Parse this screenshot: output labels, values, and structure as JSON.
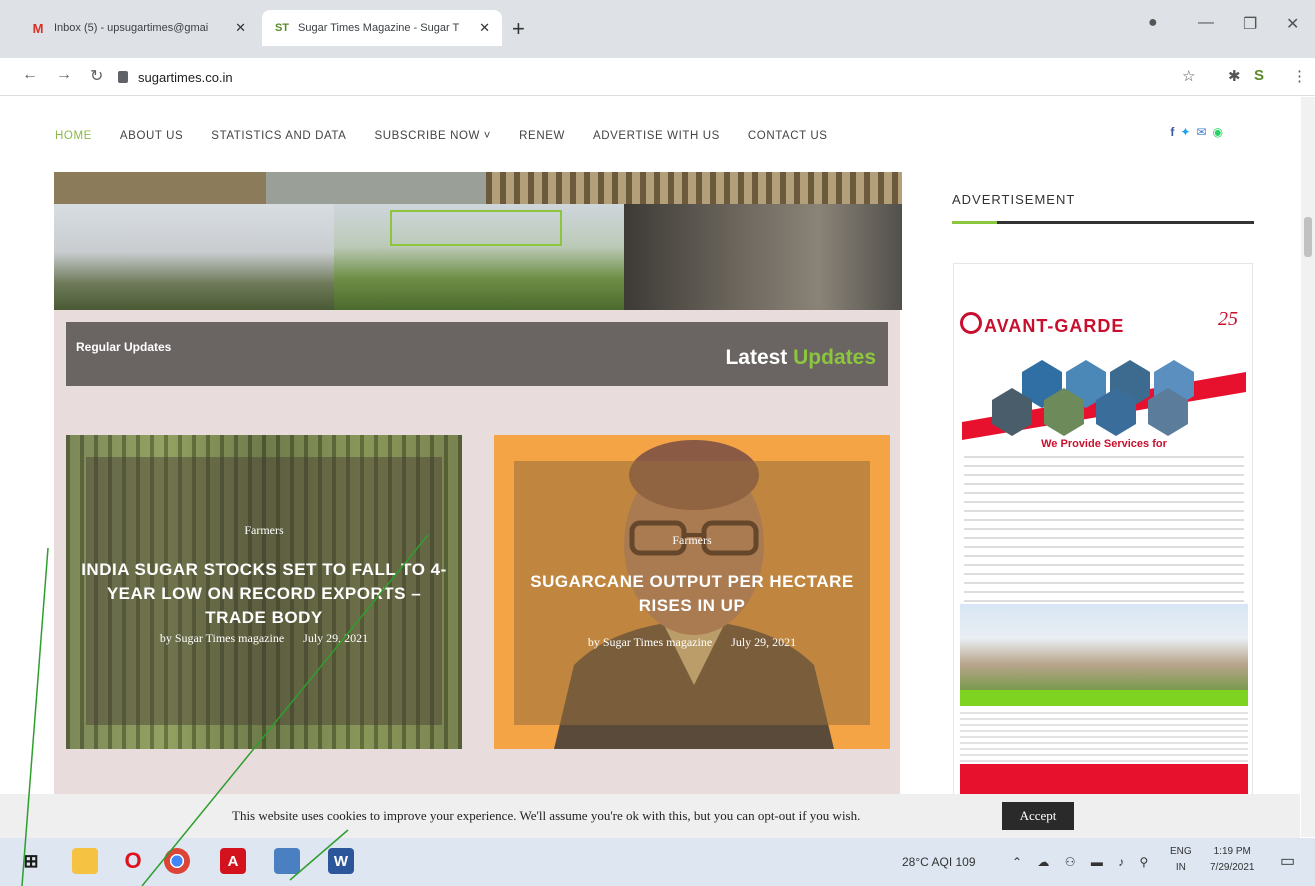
{
  "browser": {
    "tabs": [
      {
        "icon": "M",
        "title": "Inbox (5) - upsugartimes@gmai",
        "active": false
      },
      {
        "icon": "ST",
        "title": "Sugar Times Magazine - Sugar T",
        "active": true
      }
    ],
    "url": "sugartimes.co.in"
  },
  "site": {
    "nav": [
      "HOME",
      "ABOUT US",
      "STATISTICS AND DATA",
      "SUBSCRIBE NOW ˅",
      "RENEW",
      "ADVERTISE WITH US",
      "CONTACT US"
    ],
    "social_icons": [
      "facebook-icon",
      "twitter-icon",
      "email-icon",
      "whatsapp-icon"
    ]
  },
  "updates": {
    "left_label": "Regular Updates",
    "right_label_1": "Latest",
    "right_label_2": "Updates",
    "cards": [
      {
        "category": "Farmers",
        "headline": "INDIA SUGAR STOCKS SET TO FALL TO 4-YEAR LOW ON RECORD EXPORTS – TRADE BODY",
        "author": "by Sugar Times magazine",
        "date": "July 29, 2021"
      },
      {
        "category": "Farmers",
        "headline": "SUGARCANE OUTPUT PER HECTARE RISES IN UP",
        "author": "by Sugar Times magazine",
        "date": "July 29, 2021"
      }
    ]
  },
  "sidebar": {
    "heading": "ADVERTISEMENT",
    "ad_brand": "AVANT-GARDE",
    "ad_years": "25",
    "ad_provide": "We Provide Services for"
  },
  "cookie": {
    "message": "This website uses cookies to improve your experience. We'll assume you're ok with this, but you can opt-out if you wish.",
    "accept": "Accept"
  },
  "taskbar": {
    "weather": "28°C  AQI 109",
    "lang_1": "ENG",
    "lang_2": "IN",
    "time": "1:19 PM",
    "date": "7/29/2021"
  },
  "colors": {
    "accent": "#8cc63f",
    "brand_red": "#c8102e"
  }
}
